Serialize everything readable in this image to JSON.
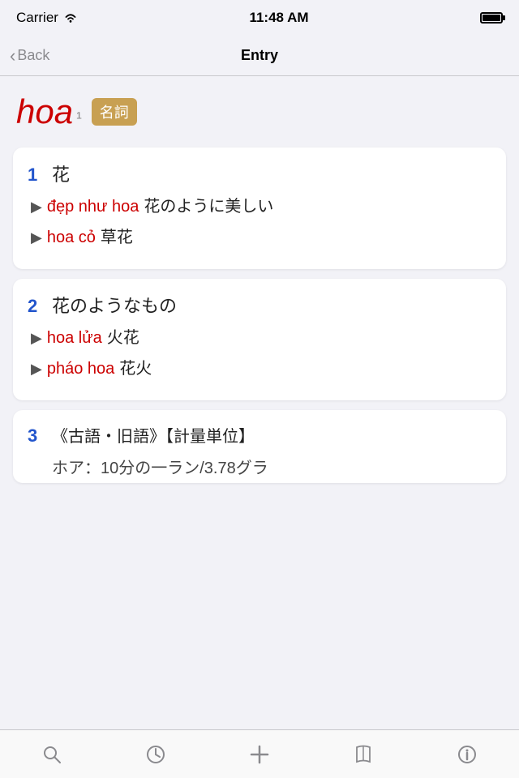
{
  "statusBar": {
    "carrier": "Carrier",
    "time": "11:48 AM"
  },
  "navBar": {
    "backLabel": "Back",
    "title": "Entry"
  },
  "wordHeader": {
    "word": "hoa",
    "tone": "¹",
    "badge": "名詞"
  },
  "definitions": [
    {
      "number": "1",
      "text": "花",
      "examples": [
        {
          "viet": "đẹp như hoa",
          "jp": "花のように美しい"
        },
        {
          "viet": "hoa cỏ",
          "jp": "草花"
        }
      ]
    },
    {
      "number": "2",
      "text": "花のようなもの",
      "examples": [
        {
          "viet": "hoa lửa",
          "jp": "火花"
        },
        {
          "viet": "pháo hoa",
          "jp": "花火"
        }
      ]
    },
    {
      "number": "3",
      "text": "《古語・旧語》【計量単位】",
      "partial": "ホア：10分の一ラン/3.78グラ",
      "examples": []
    }
  ],
  "tabBar": {
    "items": [
      "search",
      "history",
      "add",
      "book",
      "info"
    ]
  }
}
